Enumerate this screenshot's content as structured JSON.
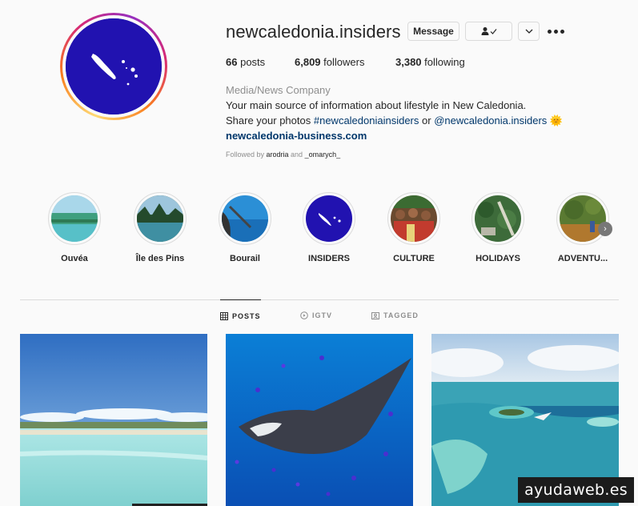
{
  "profile": {
    "username": "newcaledonia.insiders",
    "message_label": "Message",
    "stats": {
      "posts_count": "66",
      "posts_label": "posts",
      "followers_count": "6,809",
      "followers_label": "followers",
      "following_count": "3,380",
      "following_label": "following"
    },
    "bio": {
      "category": "Media/News Company",
      "line1": "Your main source of information about lifestyle in New Caledonia.",
      "line2_prefix": "Share your photos ",
      "hashtag": "#newcaledoniainsiders",
      "line2_or": " or ",
      "mention": "@newcaledonia.insiders",
      "emoji": "🌞",
      "website": "newcaledonia-business.com"
    },
    "followed_by": {
      "prefix": "Followed by ",
      "user1": "arodria",
      "and": " and ",
      "user2": "_omarych_"
    }
  },
  "highlights": [
    {
      "label": "Ouvéa"
    },
    {
      "label": "Île des Pins"
    },
    {
      "label": "Bourail"
    },
    {
      "label": "INSIDERS"
    },
    {
      "label": "CULTURE"
    },
    {
      "label": "HOLIDAYS"
    },
    {
      "label": "ADVENTU..."
    }
  ],
  "tabs": {
    "posts": "POSTS",
    "igtv": "IGTV",
    "tagged": "TAGGED"
  },
  "watermark": "ayudaweb.es",
  "colors": {
    "text": "#262626",
    "secondary": "#8e8e8e",
    "link": "#00376b",
    "avatar_bg": "#2112b0",
    "border": "#dbdbdb"
  }
}
